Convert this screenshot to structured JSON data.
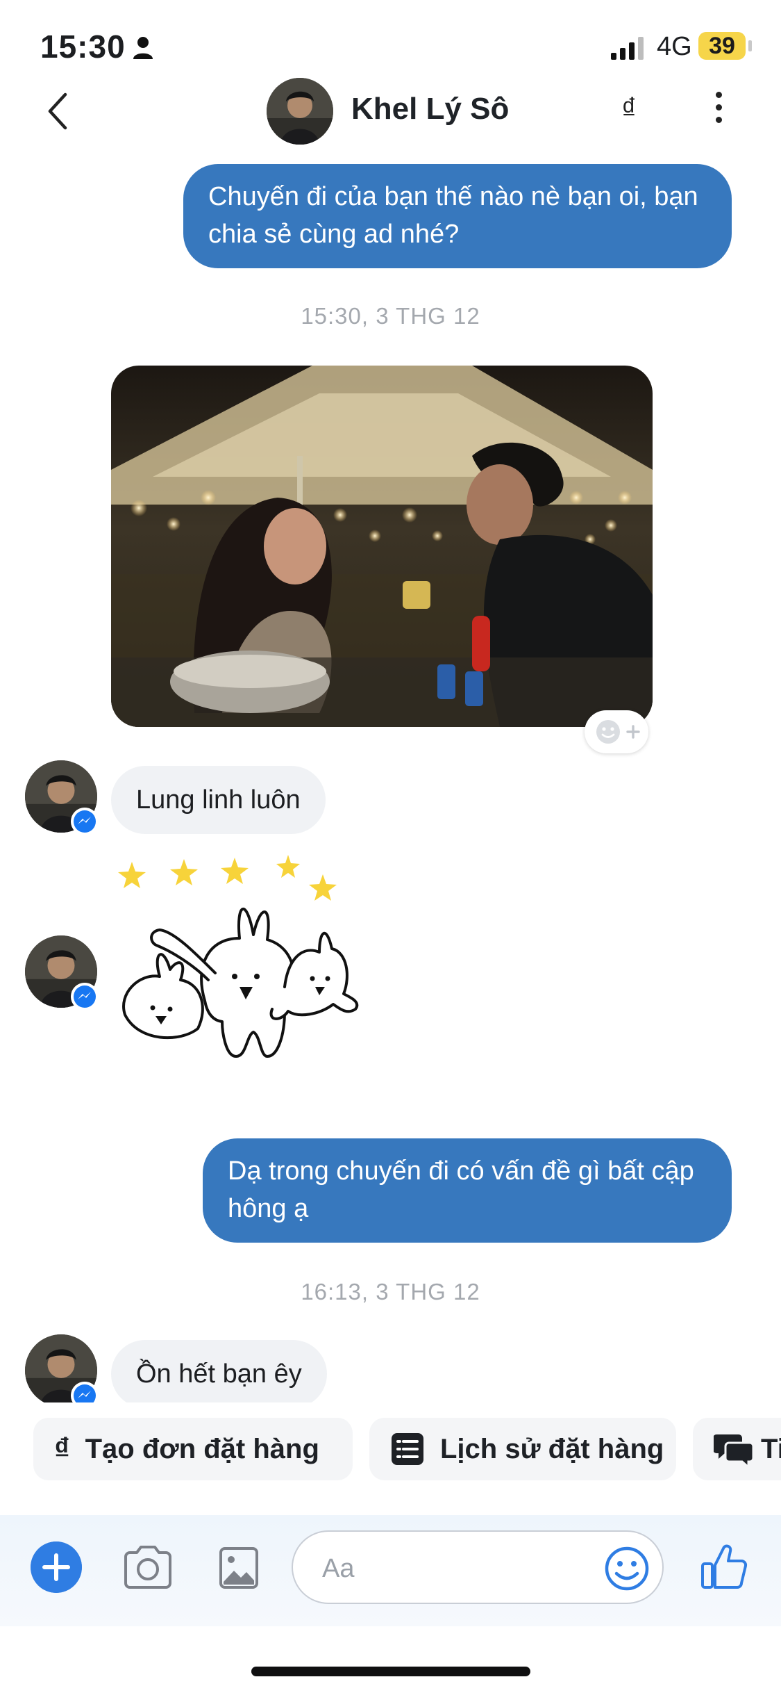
{
  "status_bar": {
    "time": "15:30",
    "network": "4G",
    "battery": "39",
    "icons": [
      "person-icon",
      "signal-icon",
      "battery-icon"
    ]
  },
  "header": {
    "contact_name": "Khel Lý Sô",
    "currency_glyph": "₫",
    "icons": [
      "back-chevron-icon",
      "avatar",
      "dong-icon",
      "more-vertical-icon"
    ]
  },
  "messages": {
    "m1": {
      "text": "Chuyến đi của bạn thế nào nè bạn oi, bạn chia sẻ cùng ad nhé?",
      "direction": "outgoing"
    },
    "ts1": "15:30, 3 THG 12",
    "photo": {
      "direction": "incoming",
      "type": "image"
    },
    "m2": {
      "text": "Lung linh luôn",
      "direction": "incoming"
    },
    "sticker": {
      "direction": "incoming",
      "type": "sticker"
    },
    "m3": {
      "text": "Dạ trong chuyến đi có vấn đề gì bất cập hông ạ",
      "direction": "outgoing"
    },
    "ts2": "16:13, 3 THG 12",
    "m4": {
      "text": "Ồn hết bạn êy",
      "direction": "incoming"
    }
  },
  "quick_actions": [
    {
      "label": "Tạo đơn đặt hàng",
      "icon": "dong-icon"
    },
    {
      "label": "Lịch sử đặt hàng",
      "icon": "list-icon"
    },
    {
      "label": "Ti",
      "icon": "chat-bubbles-icon"
    }
  ],
  "composer": {
    "placeholder": "Aa",
    "icons": [
      "plus-icon",
      "camera-icon",
      "gallery-icon",
      "emoji-icon",
      "thumbs-up-icon"
    ]
  },
  "colors": {
    "outgoing_bubble": "#3778be",
    "incoming_bubble": "#f0f2f5",
    "accent": "#2f7de3",
    "messenger_badge": "#1877f2",
    "battery": "#f6d54a"
  }
}
